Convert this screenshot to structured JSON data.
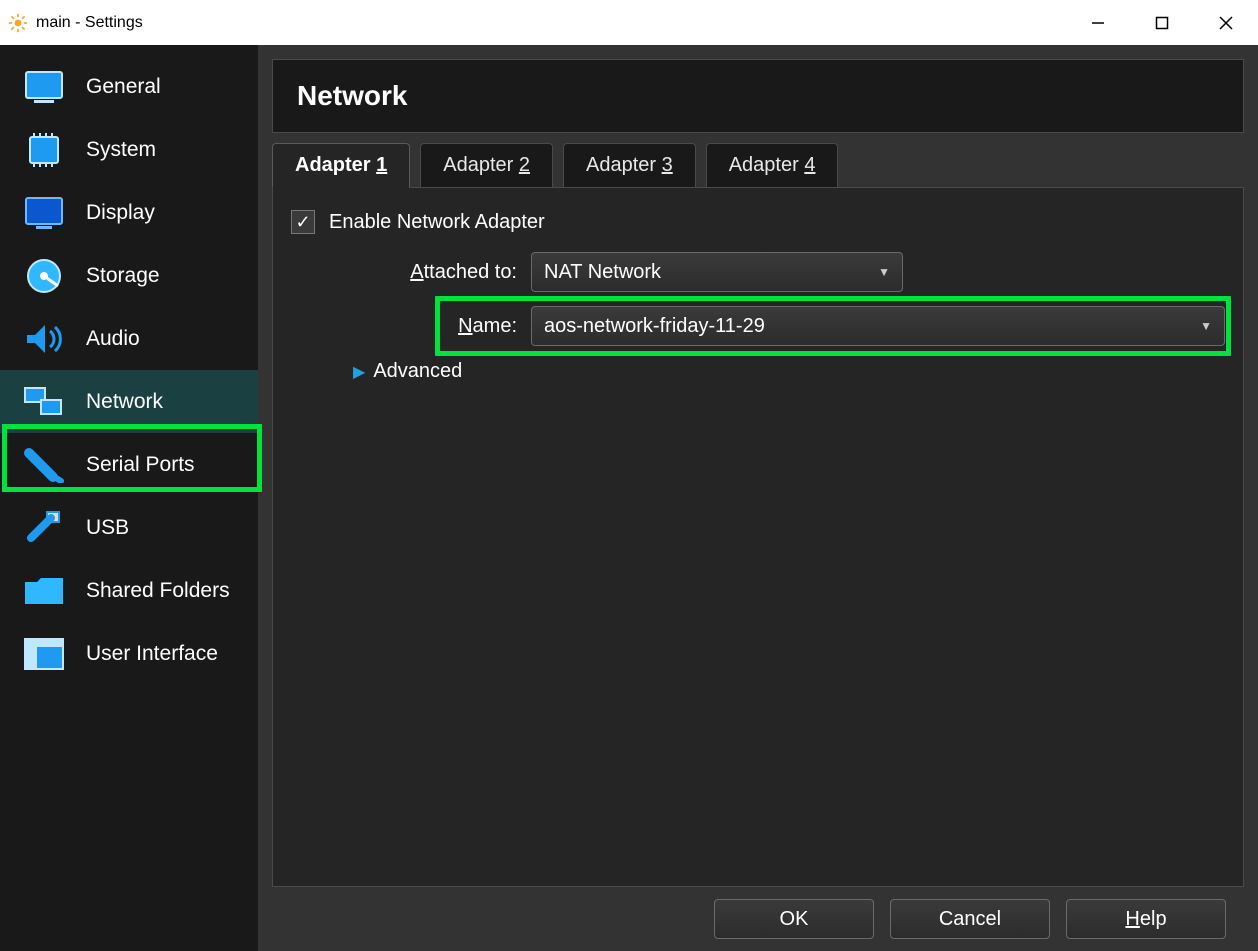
{
  "window": {
    "title": "main - Settings"
  },
  "sidebar": {
    "items": [
      {
        "label": "General"
      },
      {
        "label": "System"
      },
      {
        "label": "Display"
      },
      {
        "label": "Storage"
      },
      {
        "label": "Audio"
      },
      {
        "label": "Network"
      },
      {
        "label": "Serial Ports"
      },
      {
        "label": "USB"
      },
      {
        "label": "Shared Folders"
      },
      {
        "label": "User Interface"
      }
    ],
    "selected_index": 5
  },
  "page": {
    "title": "Network",
    "tabs": [
      {
        "prefix": "Adapter ",
        "accel": "1"
      },
      {
        "prefix": "Adapter ",
        "accel": "2"
      },
      {
        "prefix": "Adapter ",
        "accel": "3"
      },
      {
        "prefix": "Adapter ",
        "accel": "4"
      }
    ],
    "active_tab": 0,
    "enable_label_accel": "E",
    "enable_label_rest": "nable Network Adapter",
    "enable_checked": true,
    "attached_label_accel": "A",
    "attached_label_rest": "ttached to:",
    "attached_value": "NAT Network",
    "name_label_accel": "N",
    "name_label_rest": "ame:",
    "name_value": "aos-network-friday-11-29",
    "advanced_accel": "A",
    "advanced_rest": "dvanced"
  },
  "footer": {
    "ok": "OK",
    "cancel": "Cancel",
    "help_accel": "H",
    "help_rest": "elp"
  }
}
